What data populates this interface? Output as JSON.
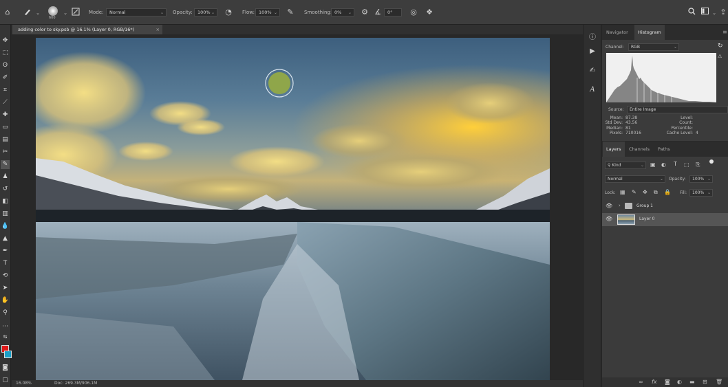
{
  "options_bar": {
    "mode_label": "Mode:",
    "mode_value": "Normal",
    "opacity_label": "Opacity:",
    "opacity_value": "100%",
    "flow_label": "Flow:",
    "flow_value": "100%",
    "smoothing_label": "Smoothing:",
    "smoothing_value": "0%",
    "angle_value": "0°",
    "brush_size": "600"
  },
  "document": {
    "tab_title": "adding color to sky.psb @ 16.1% (Layer 0, RGB/16*)",
    "close_glyph": "×"
  },
  "status_bar": {
    "zoom": "16.08%",
    "doc_info": "Doc: 269.3M/906.1M"
  },
  "colors": {
    "foreground": "#e01a1a",
    "background": "#1aa0c8",
    "brush_cursor": "#8fa64a"
  },
  "histogram_panel": {
    "tabs": [
      {
        "label": "Navigator"
      },
      {
        "label": "Histogram"
      }
    ],
    "channel_label": "Channel:",
    "channel_value": "RGB",
    "source_label": "Source:",
    "source_value": "Entire Image",
    "stats_left": [
      {
        "k": "Mean:",
        "v": "87.38"
      },
      {
        "k": "Std Dev:",
        "v": "43.56"
      },
      {
        "k": "Median:",
        "v": "81"
      },
      {
        "k": "Pixels:",
        "v": "710016"
      }
    ],
    "stats_right": [
      {
        "k": "Level:",
        "v": ""
      },
      {
        "k": "Count:",
        "v": ""
      },
      {
        "k": "Percentile:",
        "v": ""
      },
      {
        "k": "Cache Level:",
        "v": "4"
      }
    ]
  },
  "layers_panel": {
    "tabs": [
      {
        "label": "Layers"
      },
      {
        "label": "Channels"
      },
      {
        "label": "Paths"
      }
    ],
    "filter_value": "Kind",
    "blend_value": "Normal",
    "opacity_label": "Opacity:",
    "opacity_value": "100%",
    "lock_label": "Lock:",
    "fill_label": "Fill:",
    "fill_value": "100%",
    "layers": [
      {
        "name": "Group 1"
      },
      {
        "name": "Layer 0"
      }
    ]
  }
}
